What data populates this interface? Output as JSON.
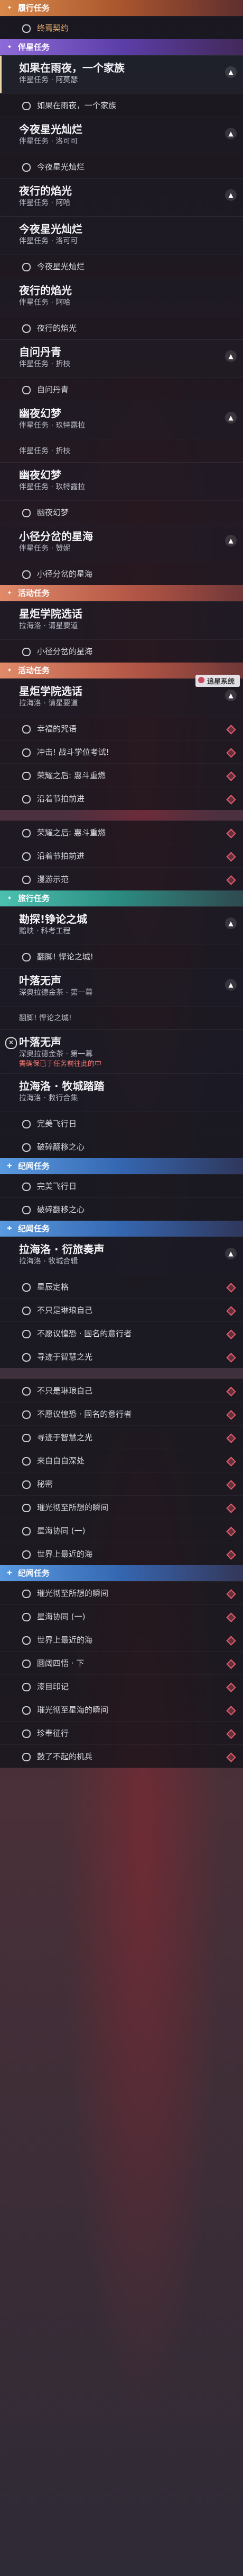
{
  "sections": [
    {
      "kind": "header",
      "style": "h-orange",
      "icon": "✦",
      "title": "履行任务"
    },
    {
      "kind": "sub",
      "text": "终焉契约",
      "sel": true
    },
    {
      "kind": "header",
      "style": "h-purple",
      "icon": "✦",
      "title": "伴星任务"
    },
    {
      "kind": "quest",
      "name": "如果在雨夜，一个家族",
      "sub": "伴星任务 · 阿莫瑟",
      "selected": true,
      "marker": "chev"
    },
    {
      "kind": "sub",
      "text": "如果在雨夜，一个家族"
    },
    {
      "kind": "quest",
      "name": "今夜星光灿烂",
      "sub": "伴星任务 · 洛可可",
      "marker": "chev"
    },
    {
      "kind": "sub",
      "text": "今夜星光灿烂"
    },
    {
      "kind": "quest",
      "name": "夜行的焰光",
      "sub": "伴星任务 · 阿哈",
      "marker": "chev"
    },
    {
      "kind": "quest",
      "name": "今夜星光灿烂",
      "sub": "伴星任务 · 洛可可",
      "marker": "none"
    },
    {
      "kind": "sub",
      "text": "今夜星光灿烂"
    },
    {
      "kind": "quest",
      "name": "夜行的焰光",
      "sub": "伴星任务 · 阿哈",
      "marker": "none"
    },
    {
      "kind": "sub",
      "text": "夜行的焰光"
    },
    {
      "kind": "quest",
      "name": "自问丹青",
      "sub": "伴星任务 · 折枝",
      "marker": "chev"
    },
    {
      "kind": "sub",
      "text": "自问丹青"
    },
    {
      "kind": "quest",
      "name": "幽夜幻梦",
      "sub": "伴星任务 · 玖特露拉",
      "marker": "chev"
    },
    {
      "kind": "sub",
      "text": "伴星任务 · 折枝",
      "plain": true
    },
    {
      "kind": "quest",
      "name": "幽夜幻梦",
      "sub": "伴星任务 · 玖特露拉",
      "marker": "none"
    },
    {
      "kind": "sub",
      "text": "幽夜幻梦"
    },
    {
      "kind": "quest",
      "name": "小径分岔的星海",
      "sub": "伴星任务 · 赞妮",
      "marker": "chev"
    },
    {
      "kind": "sub",
      "text": "小径分岔的星海"
    },
    {
      "kind": "header",
      "style": "h-salmon",
      "icon": "✦",
      "title": "活动任务"
    },
    {
      "kind": "quest",
      "name": "星炬学院选话",
      "sub": "拉海洛 · 请星要道",
      "marker": "none"
    },
    {
      "kind": "sub",
      "text": "小径分岔的星海"
    },
    {
      "kind": "header",
      "style": "h-salmon",
      "icon": "✦",
      "title": "活动任务"
    },
    {
      "kind": "quest",
      "name": "星炬学院选话",
      "sub": "拉海洛 · 请星要道",
      "marker": "chev",
      "badge": "追星系统"
    },
    {
      "kind": "sub",
      "text": "幸福的咒语",
      "diamond": true
    },
    {
      "kind": "sub",
      "text": "冲击! 战斗学位考试!",
      "diamond": true
    },
    {
      "kind": "sub",
      "text": "荣耀之后: 惠斗重燃",
      "diamond": true
    },
    {
      "kind": "sub",
      "text": "沿着节拍前进",
      "diamond": true
    },
    {
      "kind": "sep"
    },
    {
      "kind": "sub",
      "text": "荣耀之后: 惠斗重燃",
      "diamond": true
    },
    {
      "kind": "sub",
      "text": "沿着节拍前进",
      "diamond": true
    },
    {
      "kind": "sub",
      "text": "漫游示范",
      "diamond": true
    },
    {
      "kind": "header",
      "style": "h-teal",
      "icon": "✦",
      "title": "旅行任务"
    },
    {
      "kind": "quest",
      "name": "勘探!铮论之城",
      "sub": "黯映 · 科考工程",
      "marker": "chev"
    },
    {
      "kind": "sub",
      "text": "翻脚! 悍论之城!"
    },
    {
      "kind": "quest",
      "name": "叶落无声",
      "sub": "深奥拉德金茶 · 第一幕",
      "marker": "chev"
    },
    {
      "kind": "sub",
      "text": "翻脚! 悍论之城!",
      "plain": true
    },
    {
      "kind": "quest",
      "name": "叶落无声",
      "sub": "深奥拉德金茶 · 第一幕",
      "marker": "none",
      "mark": "✕",
      "warn": "需确保已于任务前往此的中"
    },
    {
      "kind": "quest",
      "name": "拉海洛 · 牧城踏踏",
      "sub": "拉海洛 · 救行合集",
      "marker": "none"
    },
    {
      "kind": "sub",
      "text": "完美飞行日"
    },
    {
      "kind": "sub",
      "text": "破碎翻移之心"
    },
    {
      "kind": "header",
      "style": "h-blue",
      "icon": "✚",
      "title": "纪闻任务"
    },
    {
      "kind": "sub",
      "text": "完美飞行日"
    },
    {
      "kind": "sub",
      "text": "破碎翻移之心"
    },
    {
      "kind": "header",
      "style": "h-blue",
      "icon": "✚",
      "title": "纪闻任务"
    },
    {
      "kind": "quest",
      "name": "拉海洛 · 衍旅奏声",
      "sub": "拉海洛 · 牧城合辑",
      "marker": "chev"
    },
    {
      "kind": "sub",
      "text": "星辰定格",
      "diamond": true
    },
    {
      "kind": "sub",
      "text": "不只是琳琅自己",
      "diamond": true
    },
    {
      "kind": "sub",
      "text": "不愿议惶恐 · 固名的意行者",
      "diamond": true
    },
    {
      "kind": "sub",
      "text": "寻迹于智慧之光",
      "diamond": true
    },
    {
      "kind": "sep"
    },
    {
      "kind": "sub",
      "text": "不只是琳琅自己",
      "diamond": true
    },
    {
      "kind": "sub",
      "text": "不愿议惶恐 · 固名的意行者",
      "diamond": true
    },
    {
      "kind": "sub",
      "text": "寻迹于智慧之光",
      "diamond": true
    },
    {
      "kind": "sub",
      "text": "来自自自深处",
      "diamond": true
    },
    {
      "kind": "sub",
      "text": "秘密",
      "diamond": true
    },
    {
      "kind": "sub",
      "text": "璀光彻至所想的瞬间",
      "diamond": true
    },
    {
      "kind": "sub",
      "text": "星海协同 (一)",
      "diamond": true
    },
    {
      "kind": "sub",
      "text": "世界上最近的海",
      "diamond": true
    },
    {
      "kind": "header",
      "style": "h-blue",
      "icon": "✚",
      "title": "纪闻任务"
    },
    {
      "kind": "sub",
      "text": "璀光彻至所想的瞬间",
      "diamond": true
    },
    {
      "kind": "sub",
      "text": "星海协同 (一)",
      "diamond": true
    },
    {
      "kind": "sub",
      "text": "世界上最近的海",
      "diamond": true
    },
    {
      "kind": "sub",
      "text": "圆阔四悟 · 下",
      "diamond": true
    },
    {
      "kind": "sub",
      "text": "漆目印记",
      "diamond": true
    },
    {
      "kind": "sub",
      "text": "璀光彻至星海的瞬间",
      "diamond": true
    },
    {
      "kind": "sub",
      "text": "珍奉征行",
      "diamond": true
    },
    {
      "kind": "sub",
      "text": "鼓了不起的机兵",
      "diamond": true
    }
  ]
}
